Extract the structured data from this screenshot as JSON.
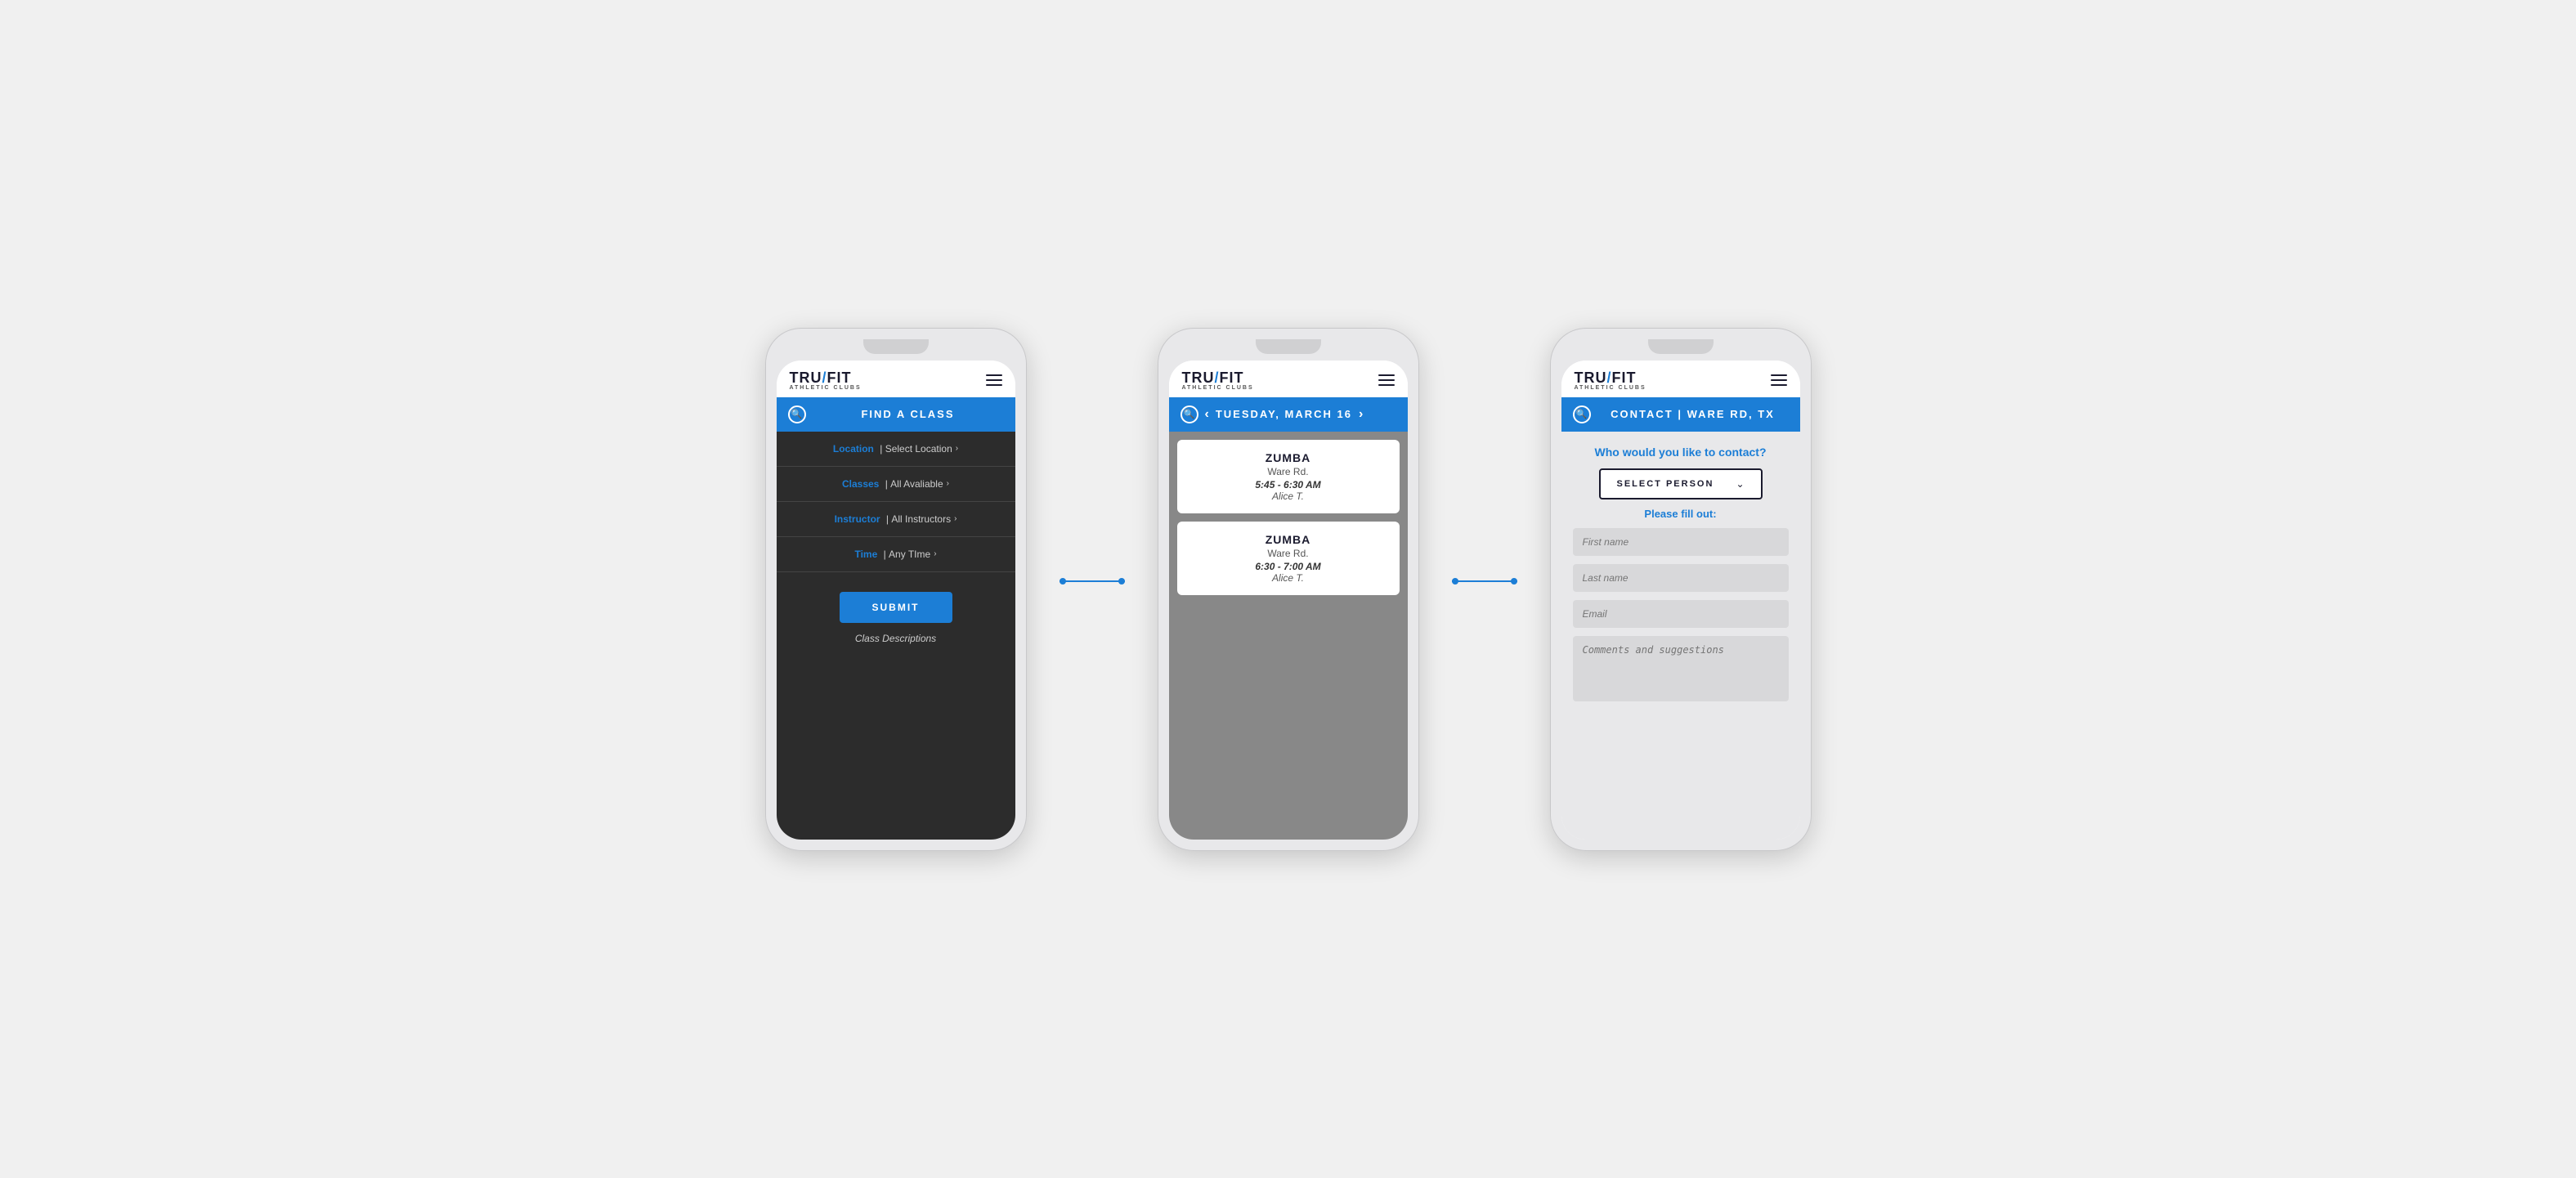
{
  "app": {
    "logo_main_prefix": "TRU",
    "logo_slash": "/",
    "logo_main_suffix": "FIT",
    "logo_sub": "ATHLETIC CLUBS"
  },
  "phone1": {
    "header_title": "FIND A CLASS",
    "filters": [
      {
        "label": "Location",
        "separator": "|",
        "value": "Select Location",
        "arrow": "›"
      },
      {
        "label": "Classes",
        "separator": "|",
        "value": "All Avaliable",
        "arrow": "›"
      },
      {
        "label": "Instructor",
        "separator": "|",
        "value": "All Instructors",
        "arrow": "›"
      },
      {
        "label": "Time",
        "separator": "|",
        "value": "Any TIme",
        "arrow": "›"
      }
    ],
    "submit_label": "SUBMIT",
    "class_desc_label": "Class Descriptions"
  },
  "phone2": {
    "header_title": "TUESDAY, MARCH 16",
    "nav_prev": "‹",
    "nav_next": "›",
    "classes": [
      {
        "title": "ZUMBA",
        "location": "Ware Rd.",
        "time": "5:45 - 6:30 AM",
        "instructor": "Alice T."
      },
      {
        "title": "ZUMBA",
        "location": "Ware Rd.",
        "time": "6:30 - 7:00 AM",
        "instructor": "Alice T."
      }
    ]
  },
  "phone3": {
    "header_title": "CONTACT | WARE RD, TX",
    "question": "Who would you like to contact?",
    "select_person_label": "SELECT PERSON",
    "please_fill_label": "Please fill out:",
    "fields": [
      {
        "placeholder": "First name"
      },
      {
        "placeholder": "Last name"
      },
      {
        "placeholder": "Email"
      }
    ],
    "comments_placeholder": "Comments and suggestions"
  },
  "colors": {
    "blue": "#1c7ed6",
    "dark": "#1a1a2e",
    "darkbg": "#2c2c2c",
    "graybg": "#888888",
    "lightgray": "#e8e8ea"
  }
}
